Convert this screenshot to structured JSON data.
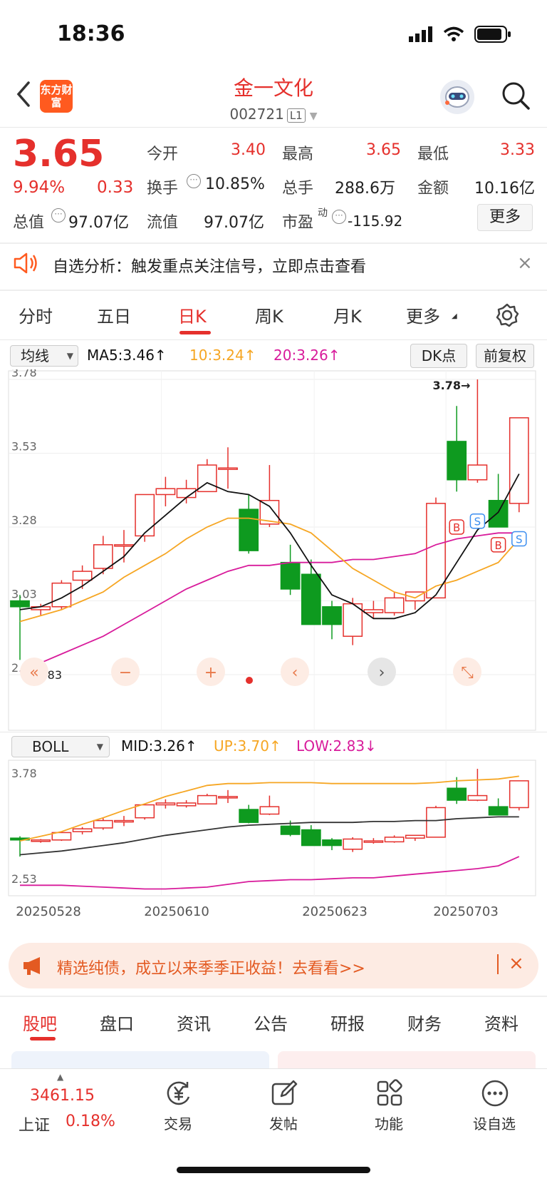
{
  "status": {
    "time": "18:36"
  },
  "header": {
    "logo": "东方财富",
    "title": "金一文化",
    "code": "002721",
    "level": "L1"
  },
  "quote": {
    "price": "3.65",
    "change_pct": "9.94%",
    "change": "0.33",
    "open_label": "今开",
    "open": "3.40",
    "high_label": "最高",
    "high": "3.65",
    "low_label": "最低",
    "low": "3.33",
    "turnover_label": "换手",
    "turnover": "10.85%",
    "volume_label": "总手",
    "volume": "288.6万",
    "amount_label": "金额",
    "amount": "10.16亿",
    "mktcap_label": "总值",
    "mktcap": "97.07亿",
    "float_label": "流值",
    "float": "97.07亿",
    "pe_label": "市盈",
    "pe_sup": "动",
    "pe": "-115.92",
    "more": "更多"
  },
  "notice": {
    "text": "自选分析：触发重点关注信号，立即点击查看",
    "close": "×"
  },
  "ktabs": [
    "分时",
    "五日",
    "日K",
    "周K",
    "月K",
    "更多"
  ],
  "ma_row": {
    "select": "均线",
    "ma5": "MA5:3.46↑",
    "ma10": "10:3.24↑",
    "ma20": "20:3.26↑",
    "dk": "DK点",
    "adjust": "前复权"
  },
  "boll_row": {
    "select": "BOLL",
    "mid": "MID:3.26↑",
    "up": "UP:3.70↑",
    "low": "LOW:2.83↓"
  },
  "colors": {
    "up": "#e5302c",
    "down": "#0e9a1f",
    "ma5": "#111111",
    "ma10": "#f6a623",
    "ma20": "#d81b9b",
    "accent": "#ff5a1f"
  },
  "chart_data": [
    {
      "type": "candlestick",
      "y_ticks": [
        "3.78",
        "3.53",
        "3.28",
        "3.03",
        "2.78"
      ],
      "ylim": [
        2.78,
        3.78
      ],
      "annotations": {
        "high": "3.78→",
        "low": "⇐2.83"
      },
      "candles": [
        {
          "o": 3.03,
          "c": 3.01,
          "h": 3.05,
          "l": 2.83
        },
        {
          "o": 3.0,
          "c": 3.01,
          "h": 3.02,
          "l": 2.98
        },
        {
          "o": 3.01,
          "c": 3.09,
          "h": 3.1,
          "l": 3.0
        },
        {
          "o": 3.1,
          "c": 3.13,
          "h": 3.15,
          "l": 3.07
        },
        {
          "o": 3.14,
          "c": 3.22,
          "h": 3.25,
          "l": 3.12
        },
        {
          "o": 3.22,
          "c": 3.22,
          "h": 3.27,
          "l": 3.16
        },
        {
          "o": 3.25,
          "c": 3.39,
          "h": 3.39,
          "l": 3.23
        },
        {
          "o": 3.39,
          "c": 3.41,
          "h": 3.45,
          "l": 3.35
        },
        {
          "o": 3.38,
          "c": 3.41,
          "h": 3.44,
          "l": 3.36
        },
        {
          "o": 3.4,
          "c": 3.49,
          "h": 3.51,
          "l": 3.4
        },
        {
          "o": 3.48,
          "c": 3.48,
          "h": 3.55,
          "l": 3.41
        },
        {
          "o": 3.34,
          "c": 3.2,
          "h": 3.39,
          "l": 3.19
        },
        {
          "o": 3.29,
          "c": 3.37,
          "h": 3.49,
          "l": 3.28
        },
        {
          "o": 3.16,
          "c": 3.07,
          "h": 3.22,
          "l": 3.05
        },
        {
          "o": 3.12,
          "c": 2.95,
          "h": 3.17,
          "l": 2.95
        },
        {
          "o": 3.01,
          "c": 2.95,
          "h": 3.03,
          "l": 2.9
        },
        {
          "o": 2.91,
          "c": 3.02,
          "h": 3.04,
          "l": 2.88
        },
        {
          "o": 2.99,
          "c": 3.0,
          "h": 3.03,
          "l": 2.97
        },
        {
          "o": 2.99,
          "c": 3.04,
          "h": 3.06,
          "l": 2.98
        },
        {
          "o": 3.03,
          "c": 3.06,
          "h": 3.06,
          "l": 3.0
        },
        {
          "o": 3.04,
          "c": 3.36,
          "h": 3.38,
          "l": 3.04
        },
        {
          "o": 3.57,
          "c": 3.44,
          "h": 3.69,
          "l": 3.4
        },
        {
          "o": 3.44,
          "c": 3.49,
          "h": 3.78,
          "l": 3.43
        },
        {
          "o": 3.37,
          "c": 3.28,
          "h": 3.46,
          "l": 3.28
        },
        {
          "o": 3.36,
          "c": 3.65,
          "h": 3.65,
          "l": 3.33
        }
      ],
      "ma5": [
        3.0,
        3.01,
        3.04,
        3.08,
        3.13,
        3.18,
        3.26,
        3.32,
        3.38,
        3.43,
        3.4,
        3.39,
        3.35,
        3.26,
        3.15,
        3.05,
        3.02,
        2.97,
        2.97,
        2.99,
        3.05,
        3.16,
        3.27,
        3.33,
        3.46
      ],
      "ma10": [
        2.96,
        2.98,
        3.0,
        3.03,
        3.06,
        3.11,
        3.15,
        3.19,
        3.24,
        3.28,
        3.31,
        3.31,
        3.3,
        3.29,
        3.26,
        3.2,
        3.14,
        3.1,
        3.06,
        3.04,
        3.08,
        3.1,
        3.13,
        3.16,
        3.24
      ],
      "ma20": [
        2.79,
        2.82,
        2.85,
        2.88,
        2.91,
        2.95,
        2.99,
        3.03,
        3.07,
        3.1,
        3.13,
        3.15,
        3.15,
        3.16,
        3.16,
        3.16,
        3.17,
        3.17,
        3.18,
        3.19,
        3.22,
        3.24,
        3.25,
        3.26,
        3.26
      ]
    },
    {
      "type": "boll",
      "y_ticks": [
        "3.78",
        "2.53"
      ],
      "ylim": [
        2.53,
        3.78
      ],
      "mid": [
        2.85,
        2.87,
        2.89,
        2.92,
        2.95,
        2.98,
        3.02,
        3.06,
        3.09,
        3.12,
        3.15,
        3.17,
        3.18,
        3.19,
        3.2,
        3.2,
        3.2,
        3.21,
        3.21,
        3.22,
        3.22,
        3.24,
        3.25,
        3.26,
        3.26
      ],
      "up": [
        3.0,
        3.05,
        3.1,
        3.18,
        3.25,
        3.33,
        3.4,
        3.48,
        3.54,
        3.6,
        3.62,
        3.62,
        3.63,
        3.63,
        3.63,
        3.62,
        3.62,
        3.62,
        3.62,
        3.62,
        3.63,
        3.65,
        3.66,
        3.67,
        3.7
      ],
      "low": [
        2.52,
        2.52,
        2.52,
        2.51,
        2.5,
        2.49,
        2.48,
        2.48,
        2.49,
        2.5,
        2.53,
        2.56,
        2.57,
        2.58,
        2.58,
        2.59,
        2.6,
        2.6,
        2.62,
        2.64,
        2.66,
        2.68,
        2.7,
        2.73,
        2.83
      ],
      "x_labels": [
        "20250528",
        "20250610",
        "20250623",
        "20250703"
      ]
    }
  ],
  "chart_controls": [
    "«",
    "−",
    "+",
    "‹",
    "›",
    "⤡"
  ],
  "banner": {
    "text": "精选纯债，成立以来季季正收益！去看看>>",
    "close": "×"
  },
  "bottom_tabs": [
    "股吧",
    "盘口",
    "资讯",
    "公告",
    "研报",
    "财务",
    "资料"
  ],
  "nav": {
    "index_value": "3461.15",
    "index_name": "上证",
    "index_pct": "0.18%",
    "items": [
      "交易",
      "发帖",
      "功能",
      "设自选"
    ]
  }
}
